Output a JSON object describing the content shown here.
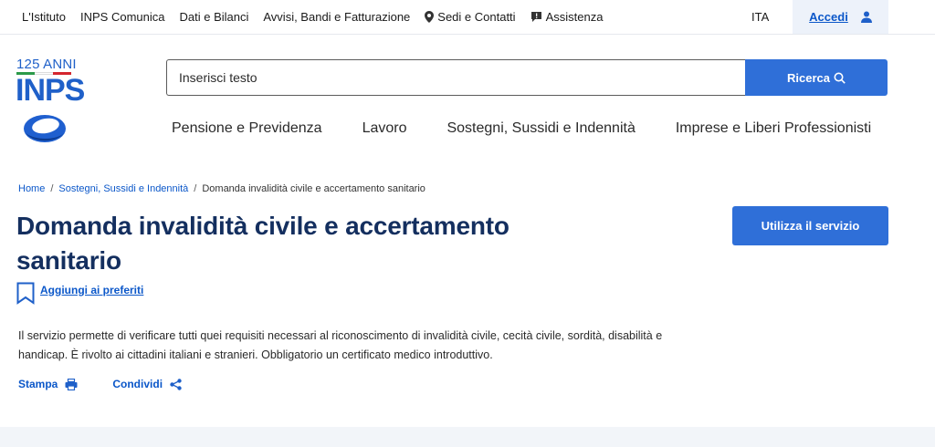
{
  "topbar": {
    "links": [
      {
        "label": "L'Istituto",
        "icon": ""
      },
      {
        "label": "INPS Comunica",
        "icon": ""
      },
      {
        "label": "Dati e Bilanci",
        "icon": ""
      },
      {
        "label": "Avvisi, Bandi e Fatturazione",
        "icon": ""
      },
      {
        "label": "Sedi e Contatti",
        "icon": "map-pin-icon"
      },
      {
        "label": "Assistenza",
        "icon": "chat-icon"
      }
    ],
    "language": "ITA",
    "login_label": "Accedi"
  },
  "logo": {
    "anniversary": "125 ANNI",
    "brand": "INPS",
    "flag_colors": [
      "#2c9a4a",
      "#ffffff",
      "#d4262e"
    ]
  },
  "search": {
    "placeholder": "Inserisci testo",
    "button_label": "Ricerca"
  },
  "main_nav": [
    "Pensione e Previdenza",
    "Lavoro",
    "Sostegni, Sussidi e Indennità",
    "Imprese e Liberi Professionisti"
  ],
  "breadcrumb": {
    "items": [
      "Home",
      "Sostegni, Sussidi e Indennità"
    ],
    "current": "Domanda invalidità civile e accertamento sanitario"
  },
  "page": {
    "title": "Domanda invalidità civile e accertamento sanitario",
    "cta_label": "Utilizza il servizio",
    "favorite_label": "Aggiungi ai preferiti",
    "description": "Il servizio permette di verificare tutti quei requisiti necessari al riconoscimento di invalidità civile, cecità civile, sordità, disabilità e handicap. È rivolto ai cittadini italiani e stranieri. Obbligatorio un certificato medico introduttivo.",
    "actions": [
      {
        "label": "Stampa",
        "icon": "print-icon"
      },
      {
        "label": "Condividi",
        "icon": "share-icon"
      }
    ]
  },
  "colors": {
    "primary": "#2f6fd8",
    "link": "#0b57c9",
    "title": "#142f5f",
    "login_bg": "#edf2fa"
  }
}
